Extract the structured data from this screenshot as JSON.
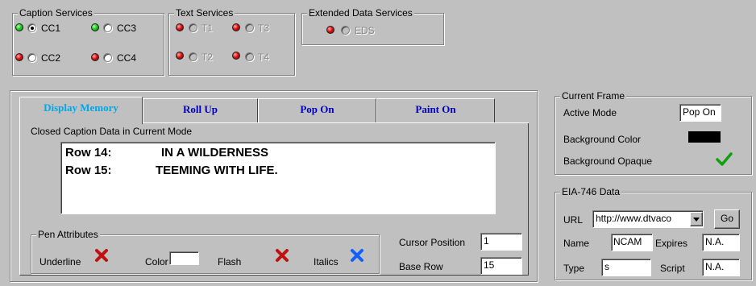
{
  "caption_services": {
    "title": "Caption Services",
    "items": [
      {
        "label": "CC1",
        "led": "green",
        "selected": true
      },
      {
        "label": "CC3",
        "led": "green",
        "selected": false
      },
      {
        "label": "CC2",
        "led": "red",
        "selected": false
      },
      {
        "label": "CC4",
        "led": "red",
        "selected": false
      }
    ]
  },
  "text_services": {
    "title": "Text Services",
    "items": [
      {
        "label": "T1",
        "led": "red"
      },
      {
        "label": "T3",
        "led": "red"
      },
      {
        "label": "T2",
        "led": "red"
      },
      {
        "label": "T4",
        "led": "red"
      }
    ]
  },
  "extended_data_services": {
    "title": "Extended Data Services",
    "items": [
      {
        "label": "EDS",
        "led": "red"
      }
    ]
  },
  "tabs": [
    {
      "label": "Display Memory",
      "active": true
    },
    {
      "label": "Roll Up",
      "active": false
    },
    {
      "label": "Pop On",
      "active": false
    },
    {
      "label": "Paint On",
      "active": false
    }
  ],
  "caption_data": {
    "label": "Closed Caption Data in Current Mode",
    "rows": [
      {
        "row": "Row 14:",
        "text": "IN A WILDERNESS"
      },
      {
        "row": "Row 15:",
        "text": "TEEMING WITH LIFE."
      }
    ]
  },
  "pen_attributes": {
    "title": "Pen Attributes",
    "underline_label": "Underline",
    "color_label": "Color",
    "flash_label": "Flash",
    "italics_label": "Italics"
  },
  "cursor": {
    "position_label": "Cursor Position",
    "position_value": "1",
    "base_row_label": "Base Row",
    "base_row_value": "15"
  },
  "current_frame": {
    "title": "Current Frame",
    "active_mode_label": "Active Mode",
    "active_mode_value": "Pop On",
    "bg_color_label": "Background Color",
    "bg_color_value": "#000000",
    "bg_opaque_label": "Background Opaque"
  },
  "eia746": {
    "title": "EIA-746 Data",
    "url_label": "URL",
    "url_value": "http://www.dtvaco",
    "go_label": "Go",
    "name_label": "Name",
    "name_value": "NCAM",
    "expires_label": "Expires",
    "expires_value": "N.A.",
    "type_label": "Type",
    "type_value": "s",
    "script_label": "Script",
    "script_value": "N.A."
  },
  "colors": {
    "led_green": "#19d019",
    "led_red": "#e01010",
    "tab_text": "#0000c0",
    "tab_active_text": "#00a8e8",
    "x_mark": "#c01010",
    "x_mark_italics": "#1060ff",
    "check_mark": "#10a010"
  }
}
